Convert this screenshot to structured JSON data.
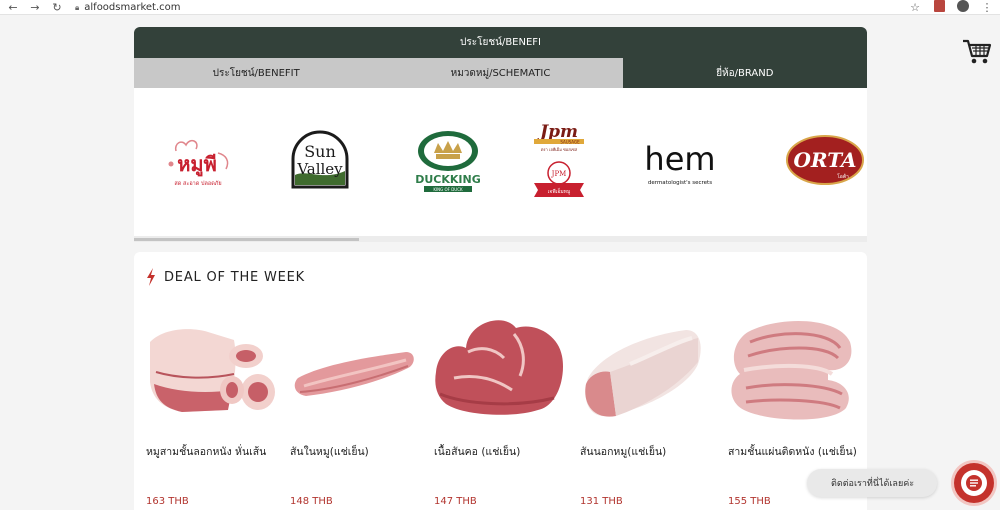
{
  "browser": {
    "url": "alfoodsmarket.com",
    "nav_icons": [
      "back-arrow-icon",
      "forward-arrow-icon",
      "reload-icon"
    ],
    "right_icons": [
      "star-icon",
      "pdf-icon",
      "account-icon",
      "menu-dots-icon"
    ]
  },
  "header": {
    "title": "ประโยชน์/BENEFI"
  },
  "tabs": [
    {
      "label": "ประโยชน์/BENEFIT",
      "active": false
    },
    {
      "label": "หมวดหมู่/SCHEMATIC",
      "active": false
    },
    {
      "label": "ยี่ห้อ/BRAND",
      "active": true
    }
  ],
  "brands": {
    "nhoomee": {
      "main": "หมูพี",
      "sub": "สด สะอาด ปลอดภัย"
    },
    "sunvalley": {
      "line1": "Sun",
      "line2": "Valley"
    },
    "duckking": {
      "name": "DUCKKING",
      "tagline": "KING OF DUCK"
    },
    "jpm": {
      "main": "Jpm",
      "sausage": "SAUSAGE",
      "sub": "ตรา เจพีเอ็ม ซอสเซส",
      "badge": "JPM",
      "ribbon": "เจพีเอ็มหมู"
    },
    "hem": {
      "main": "hem",
      "tagline": "dermatologist's secrets"
    },
    "orta": {
      "main": "ORTA",
      "sub": "โอต้า"
    }
  },
  "deals": {
    "title": "DEAL OF THE WEEK",
    "products": [
      {
        "name": "หมูสามชั้นลอกหนัง หั่นเส้น",
        "price": "163 THB"
      },
      {
        "name": "สันในหมู(แช่เย็น)",
        "price": "148 THB"
      },
      {
        "name": "เนื้อสันคอ (แช่เย็น)",
        "price": "147 THB"
      },
      {
        "name": "สันนอกหมู(แช่เย็น)",
        "price": "131 THB"
      },
      {
        "name": "สามชั้นแผ่นติดหนัง (แช่เย็น)",
        "price": "155 THB"
      }
    ]
  },
  "chat": {
    "label": "ติดต่อเราที่นี่ได้เลยค่ะ"
  },
  "colors": {
    "header_green": "#33413a",
    "price_red": "#b2352f",
    "chat_red": "#c4322c"
  }
}
